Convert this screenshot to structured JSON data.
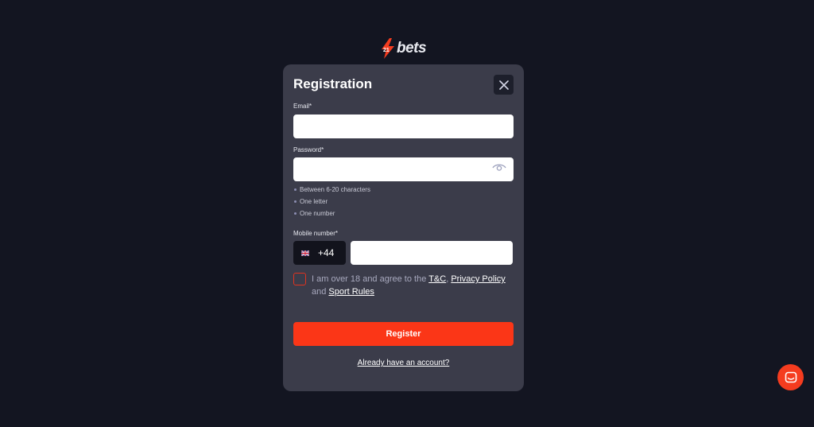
{
  "logo": {
    "mark": "21",
    "text": "bets"
  },
  "modal": {
    "title": "Registration",
    "email": {
      "label": "Email*",
      "value": "",
      "placeholder": ""
    },
    "password": {
      "label": "Password*",
      "value": "",
      "placeholder": ""
    },
    "password_rules": [
      "Between 6-20 characters",
      "One letter",
      "One number"
    ],
    "mobile": {
      "label": "Mobile number*",
      "dial_code": "+44",
      "value": "",
      "placeholder": ""
    },
    "agree": {
      "text_before": "I am over 18 and agree to the ",
      "tc": "T&C",
      "comma": ", ",
      "privacy": "Privacy Policy",
      "and": " and ",
      "sport_rules": "Sport Rules"
    },
    "register_label": "Register",
    "login_link": "Already have an account?"
  },
  "colors": {
    "accent": "#fb3617",
    "background": "#131521",
    "modal": "#3b3c4a"
  },
  "icons": {
    "close": "close-icon",
    "eye": "eye-icon",
    "flag": "uk-flag-icon",
    "chat": "chat-icon"
  }
}
